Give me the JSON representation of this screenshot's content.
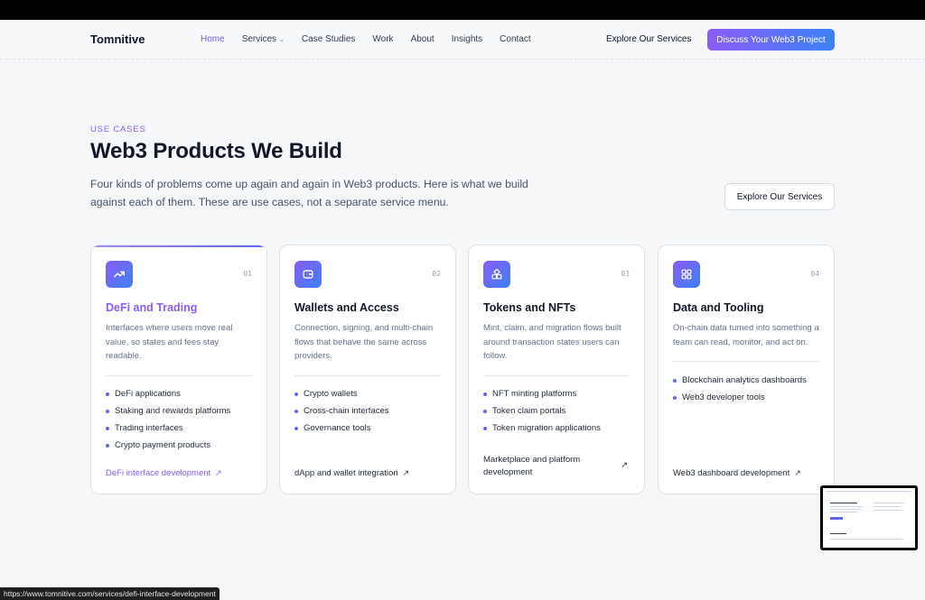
{
  "nav": {
    "brand": "Tomnitive",
    "items": [
      {
        "label": "Home",
        "active": true
      },
      {
        "label": "Services",
        "has_dropdown": true
      },
      {
        "label": "Case Studies"
      },
      {
        "label": "Work"
      },
      {
        "label": "About"
      },
      {
        "label": "Insights"
      },
      {
        "label": "Contact"
      }
    ],
    "explore_link": "Explore Our Services",
    "cta_button": "Discuss Your Web3 Project"
  },
  "section": {
    "eyebrow": "USE CASES",
    "title": "Web3 Products We Build",
    "lead": "Four kinds of problems come up again and again in Web3 products. Here is what we build against each of them. These are use cases, not a separate service menu.",
    "explore_button": "Explore Our Services"
  },
  "cards": [
    {
      "num": "01",
      "icon": "trending-up-icon",
      "title": "DeFi and Trading",
      "desc": "Interfaces where users move real value, so states and fees stay readable.",
      "items": [
        "DeFi applications",
        "Staking and rewards platforms",
        "Trading interfaces",
        "Crypto payment products"
      ],
      "link": "DeFi interface development"
    },
    {
      "num": "02",
      "icon": "wallet-icon",
      "title": "Wallets and Access",
      "desc": "Connection, signing, and multi-chain flows that behave the same across providers.",
      "items": [
        "Crypto wallets",
        "Cross-chain interfaces",
        "Governance tools"
      ],
      "link": "dApp and wallet integration"
    },
    {
      "num": "03",
      "icon": "token-blocks-icon",
      "title": "Tokens and NFTs",
      "desc": "Mint, claim, and migration flows built around transaction states users can follow.",
      "items": [
        "NFT minting platforms",
        "Token claim portals",
        "Token migration applications"
      ],
      "link": "Marketplace and platform development"
    },
    {
      "num": "04",
      "icon": "grid-icon",
      "title": "Data and Tooling",
      "desc": "On-chain data turned into something a team can read, monitor, and act on.",
      "items": [
        "Blockchain analytics dashboards",
        "Web3 developer tools"
      ],
      "link": "Web3 dashboard development"
    }
  ],
  "accent_color": "#8b5cf6",
  "status_bar_url": "https://www.tomnitive.com/services/defi-interface-development"
}
